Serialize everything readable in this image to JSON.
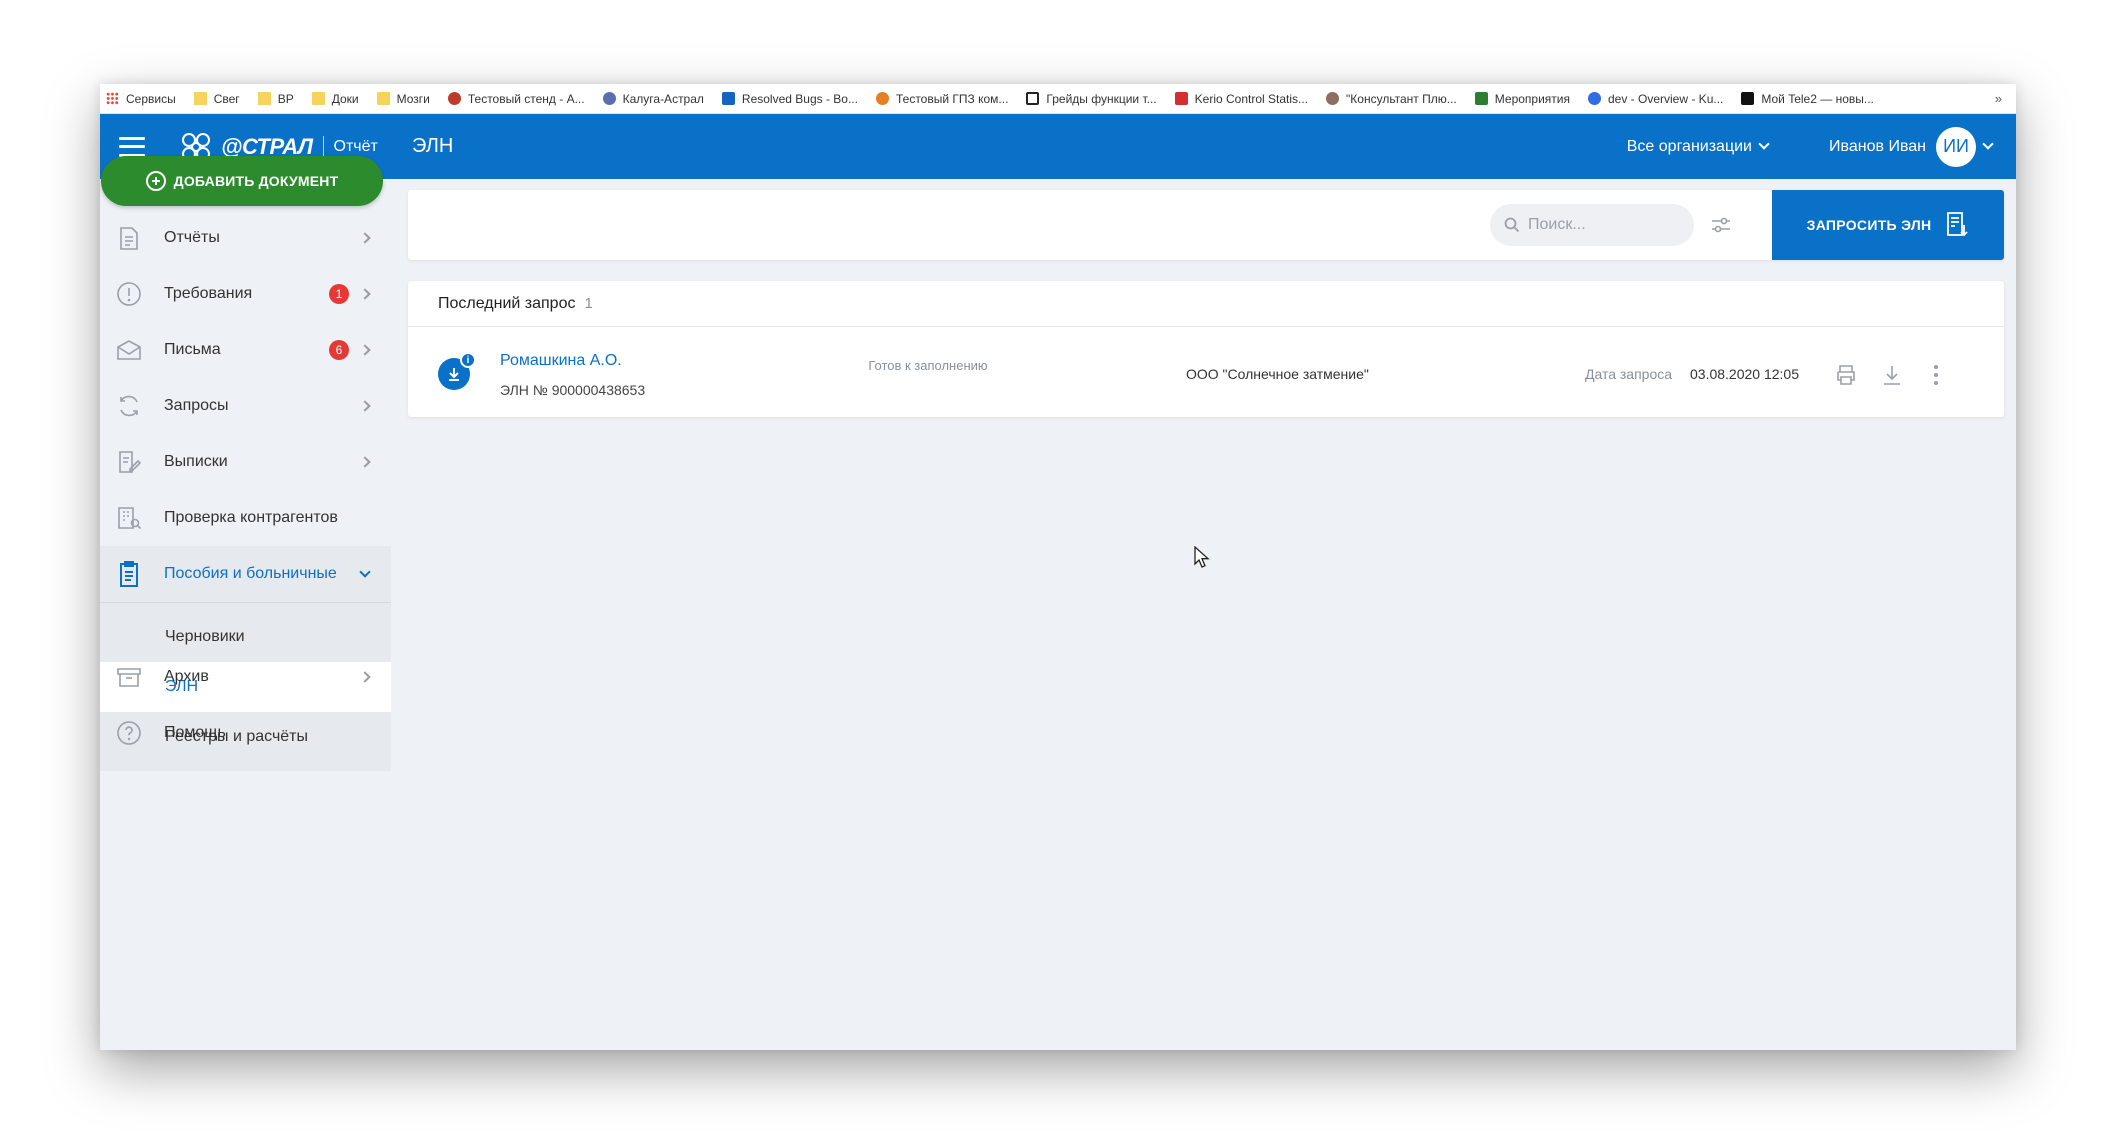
{
  "bookmarks": [
    {
      "label": "Сервисы",
      "icon": "apps-grid-icon"
    },
    {
      "label": "Свег",
      "icon": "folder-icon"
    },
    {
      "label": "ВР",
      "icon": "folder-icon"
    },
    {
      "label": "Доки",
      "icon": "folder-icon"
    },
    {
      "label": "Мозги",
      "icon": "folder-icon"
    },
    {
      "label": "Тестовый стенд - А...",
      "icon": "site-icon"
    },
    {
      "label": "Калуга-Астрал",
      "icon": "site-icon"
    },
    {
      "label": "Resolved Bugs - Bo...",
      "icon": "site-icon"
    },
    {
      "label": "Тестовый ГПЗ ком...",
      "icon": "site-icon"
    },
    {
      "label": "Грейды функции т...",
      "icon": "notion-icon"
    },
    {
      "label": "Kerio Control Statis...",
      "icon": "shield-icon"
    },
    {
      "label": "\"Консультант Плю...",
      "icon": "site-icon"
    },
    {
      "label": "Мероприятия",
      "icon": "site-icon"
    },
    {
      "label": "dev - Overview - Ku...",
      "icon": "site-icon"
    },
    {
      "label": "Мой Tele2 — новы...",
      "icon": "tele2-icon"
    }
  ],
  "bookmarks_more": "»",
  "header": {
    "logo_text": "@СТРАЛ",
    "logo_sub": "Отчёт",
    "page_title": "ЭЛН",
    "org_select": "Все организации",
    "user_name": "Иванов Иван",
    "user_initials": "ИИ"
  },
  "sidebar": {
    "add_button": "ДОБАВИТЬ ДОКУМЕНТ",
    "items": [
      {
        "label": "Отчёты"
      },
      {
        "label": "Требования",
        "badge": "1"
      },
      {
        "label": "Письма",
        "badge": "6"
      },
      {
        "label": "Запросы"
      },
      {
        "label": "Выписки"
      },
      {
        "label": "Проверка контрагентов"
      },
      {
        "label": "Пособия и больничные"
      },
      {
        "label": "Архив"
      },
      {
        "label": "Помощь"
      }
    ],
    "subitems": [
      {
        "label": "Черновики"
      },
      {
        "label": "ЭЛН"
      },
      {
        "label": "Реестры и расчёты"
      }
    ]
  },
  "toolbar": {
    "search_placeholder": "Поиск...",
    "request_button": "ЗАПРОСИТЬ ЭЛН"
  },
  "card": {
    "title": "Последний запрос",
    "count": "1",
    "rows": [
      {
        "name": "Ромашкина А.О.",
        "number": "ЭЛН № 900000438653",
        "status": "Готов к заполнению",
        "org": "ООО \"Солнечное затмение\"",
        "date_label": "Дата запроса",
        "date": "03.08.2020 12:05"
      }
    ]
  },
  "colors": {
    "brand_blue": "#0a71c8",
    "add_green": "#2c8b2c",
    "badge_red": "#e53935"
  }
}
